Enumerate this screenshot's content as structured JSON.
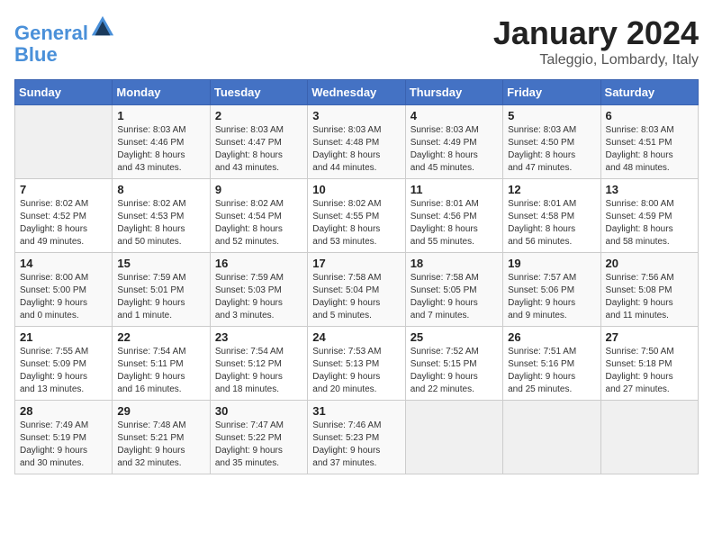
{
  "header": {
    "logo_line1": "General",
    "logo_line2": "Blue",
    "title": "January 2024",
    "subtitle": "Taleggio, Lombardy, Italy"
  },
  "columns": [
    "Sunday",
    "Monday",
    "Tuesday",
    "Wednesday",
    "Thursday",
    "Friday",
    "Saturday"
  ],
  "weeks": [
    [
      {
        "day": "",
        "info": ""
      },
      {
        "day": "1",
        "info": "Sunrise: 8:03 AM\nSunset: 4:46 PM\nDaylight: 8 hours\nand 43 minutes."
      },
      {
        "day": "2",
        "info": "Sunrise: 8:03 AM\nSunset: 4:47 PM\nDaylight: 8 hours\nand 43 minutes."
      },
      {
        "day": "3",
        "info": "Sunrise: 8:03 AM\nSunset: 4:48 PM\nDaylight: 8 hours\nand 44 minutes."
      },
      {
        "day": "4",
        "info": "Sunrise: 8:03 AM\nSunset: 4:49 PM\nDaylight: 8 hours\nand 45 minutes."
      },
      {
        "day": "5",
        "info": "Sunrise: 8:03 AM\nSunset: 4:50 PM\nDaylight: 8 hours\nand 47 minutes."
      },
      {
        "day": "6",
        "info": "Sunrise: 8:03 AM\nSunset: 4:51 PM\nDaylight: 8 hours\nand 48 minutes."
      }
    ],
    [
      {
        "day": "7",
        "info": "Sunrise: 8:02 AM\nSunset: 4:52 PM\nDaylight: 8 hours\nand 49 minutes."
      },
      {
        "day": "8",
        "info": "Sunrise: 8:02 AM\nSunset: 4:53 PM\nDaylight: 8 hours\nand 50 minutes."
      },
      {
        "day": "9",
        "info": "Sunrise: 8:02 AM\nSunset: 4:54 PM\nDaylight: 8 hours\nand 52 minutes."
      },
      {
        "day": "10",
        "info": "Sunrise: 8:02 AM\nSunset: 4:55 PM\nDaylight: 8 hours\nand 53 minutes."
      },
      {
        "day": "11",
        "info": "Sunrise: 8:01 AM\nSunset: 4:56 PM\nDaylight: 8 hours\nand 55 minutes."
      },
      {
        "day": "12",
        "info": "Sunrise: 8:01 AM\nSunset: 4:58 PM\nDaylight: 8 hours\nand 56 minutes."
      },
      {
        "day": "13",
        "info": "Sunrise: 8:00 AM\nSunset: 4:59 PM\nDaylight: 8 hours\nand 58 minutes."
      }
    ],
    [
      {
        "day": "14",
        "info": "Sunrise: 8:00 AM\nSunset: 5:00 PM\nDaylight: 9 hours\nand 0 minutes."
      },
      {
        "day": "15",
        "info": "Sunrise: 7:59 AM\nSunset: 5:01 PM\nDaylight: 9 hours\nand 1 minute."
      },
      {
        "day": "16",
        "info": "Sunrise: 7:59 AM\nSunset: 5:03 PM\nDaylight: 9 hours\nand 3 minutes."
      },
      {
        "day": "17",
        "info": "Sunrise: 7:58 AM\nSunset: 5:04 PM\nDaylight: 9 hours\nand 5 minutes."
      },
      {
        "day": "18",
        "info": "Sunrise: 7:58 AM\nSunset: 5:05 PM\nDaylight: 9 hours\nand 7 minutes."
      },
      {
        "day": "19",
        "info": "Sunrise: 7:57 AM\nSunset: 5:06 PM\nDaylight: 9 hours\nand 9 minutes."
      },
      {
        "day": "20",
        "info": "Sunrise: 7:56 AM\nSunset: 5:08 PM\nDaylight: 9 hours\nand 11 minutes."
      }
    ],
    [
      {
        "day": "21",
        "info": "Sunrise: 7:55 AM\nSunset: 5:09 PM\nDaylight: 9 hours\nand 13 minutes."
      },
      {
        "day": "22",
        "info": "Sunrise: 7:54 AM\nSunset: 5:11 PM\nDaylight: 9 hours\nand 16 minutes."
      },
      {
        "day": "23",
        "info": "Sunrise: 7:54 AM\nSunset: 5:12 PM\nDaylight: 9 hours\nand 18 minutes."
      },
      {
        "day": "24",
        "info": "Sunrise: 7:53 AM\nSunset: 5:13 PM\nDaylight: 9 hours\nand 20 minutes."
      },
      {
        "day": "25",
        "info": "Sunrise: 7:52 AM\nSunset: 5:15 PM\nDaylight: 9 hours\nand 22 minutes."
      },
      {
        "day": "26",
        "info": "Sunrise: 7:51 AM\nSunset: 5:16 PM\nDaylight: 9 hours\nand 25 minutes."
      },
      {
        "day": "27",
        "info": "Sunrise: 7:50 AM\nSunset: 5:18 PM\nDaylight: 9 hours\nand 27 minutes."
      }
    ],
    [
      {
        "day": "28",
        "info": "Sunrise: 7:49 AM\nSunset: 5:19 PM\nDaylight: 9 hours\nand 30 minutes."
      },
      {
        "day": "29",
        "info": "Sunrise: 7:48 AM\nSunset: 5:21 PM\nDaylight: 9 hours\nand 32 minutes."
      },
      {
        "day": "30",
        "info": "Sunrise: 7:47 AM\nSunset: 5:22 PM\nDaylight: 9 hours\nand 35 minutes."
      },
      {
        "day": "31",
        "info": "Sunrise: 7:46 AM\nSunset: 5:23 PM\nDaylight: 9 hours\nand 37 minutes."
      },
      {
        "day": "",
        "info": ""
      },
      {
        "day": "",
        "info": ""
      },
      {
        "day": "",
        "info": ""
      }
    ]
  ]
}
